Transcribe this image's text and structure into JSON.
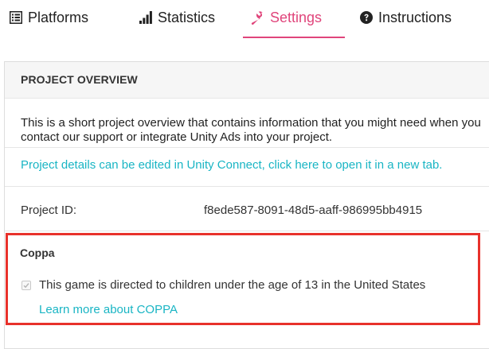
{
  "tabs": [
    {
      "label": "Platforms",
      "icon": "list-icon",
      "active": false
    },
    {
      "label": "Statistics",
      "icon": "bar-chart-icon",
      "active": false
    },
    {
      "label": "Settings",
      "icon": "wrench-icon",
      "active": true
    },
    {
      "label": "Instructions",
      "icon": "question-circle-icon",
      "active": false
    }
  ],
  "colors": {
    "accent": "#e0457b",
    "link": "#19b5c4",
    "highlight_border": "#e8312b"
  },
  "overview": {
    "title": "PROJECT OVERVIEW",
    "description": "This is a short project overview that contains information that you might need when you contact our support or integrate Unity Ads into your project.",
    "details_link": "Project details can be edited in Unity Connect, click here to open it in a new tab.",
    "project_id_label": "Project ID:",
    "project_id_value": "f8ede587-8091-48d5-aaff-986995bb4915"
  },
  "coppa": {
    "title": "Coppa",
    "checkbox_label": "This game is directed to children under the age of 13 in the United States",
    "checked": true,
    "learn_more": "Learn more about COPPA"
  }
}
